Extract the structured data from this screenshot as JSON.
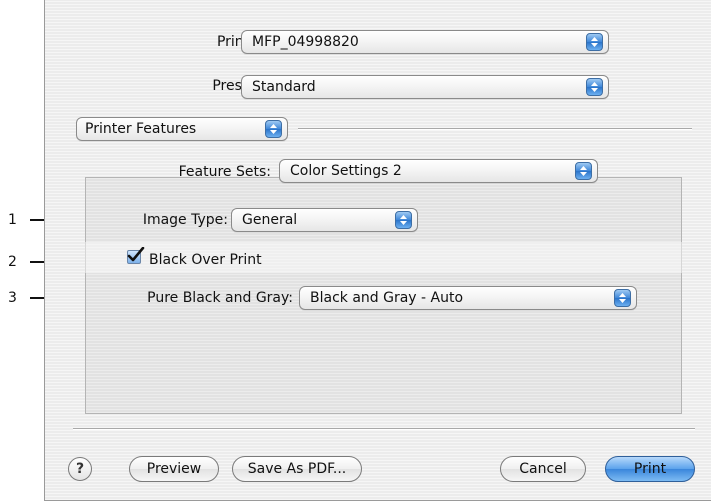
{
  "printer": {
    "label": "Printer:",
    "value": "MFP_04998820"
  },
  "presets": {
    "label": "Presets:",
    "value": "Standard"
  },
  "panel_menu": {
    "value": "Printer Features"
  },
  "feature_sets": {
    "label": "Feature Sets:",
    "value": "Color Settings 2"
  },
  "image_type": {
    "label": "Image Type:",
    "value": "General"
  },
  "black_over_print": {
    "label": "Black Over Print",
    "checked": true
  },
  "pure_black_gray": {
    "label": "Pure Black and Gray:",
    "value": "Black and Gray - Auto"
  },
  "buttons": {
    "help": "?",
    "preview": "Preview",
    "save_as_pdf": "Save As PDF...",
    "cancel": "Cancel",
    "print": "Print"
  },
  "callouts": [
    "1",
    "2",
    "3"
  ],
  "colors": {
    "accent": "#3a86dc",
    "dialog_bg": "#ececec"
  }
}
